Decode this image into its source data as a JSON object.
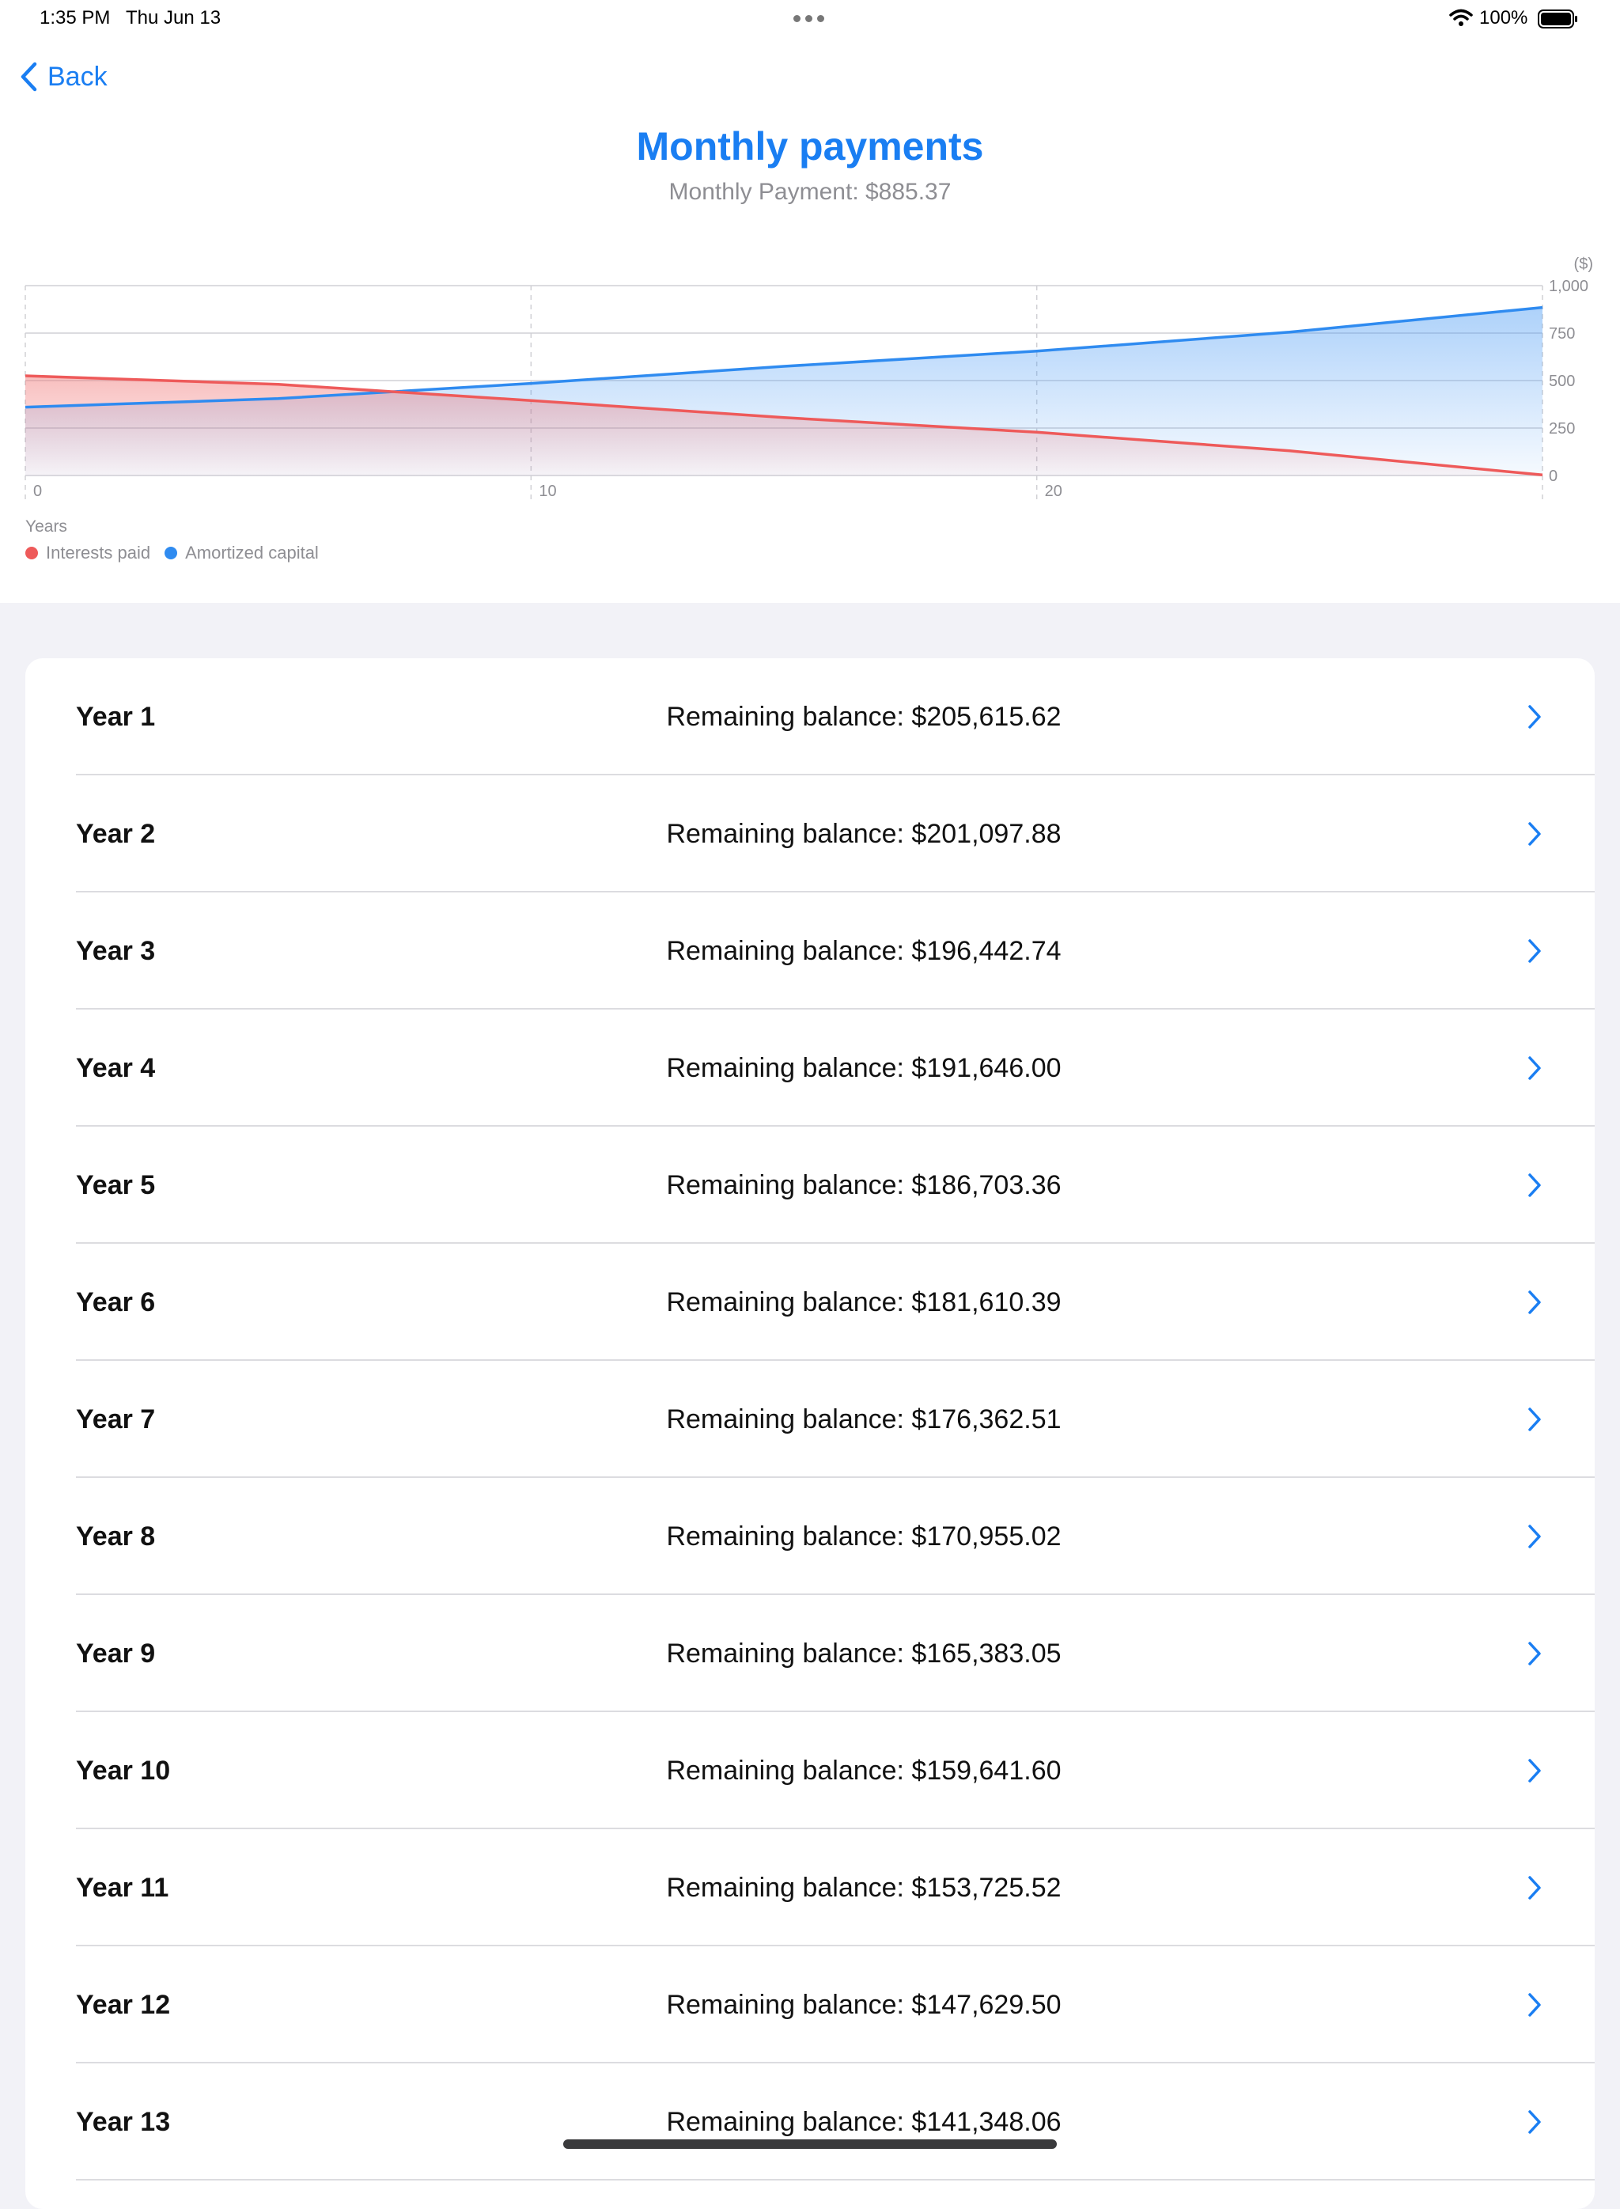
{
  "status_bar": {
    "time": "1:35 PM",
    "date": "Thu Jun 13",
    "battery": "100%"
  },
  "nav": {
    "back_label": "Back"
  },
  "header": {
    "title": "Monthly payments",
    "subtitle": "Monthly Payment: $885.37"
  },
  "chart_data": {
    "type": "area",
    "x_label": "Years",
    "y_unit": "($)",
    "x_ticks": [
      "0",
      "10",
      "20"
    ],
    "y_ticks": [
      "1,000",
      "750",
      "500",
      "250",
      "0"
    ],
    "xlim": [
      0,
      30
    ],
    "ylim": [
      0,
      1000
    ],
    "grid": true,
    "legend_position": "bottom-left",
    "series": [
      {
        "name": "Interests paid",
        "color": "#ee5a5a",
        "x": [
          0,
          5,
          10,
          15,
          20,
          25,
          30
        ],
        "values": [
          525,
          480,
          395,
          305,
          228,
          130,
          3
        ]
      },
      {
        "name": "Amortized capital",
        "color": "#2f8bf0",
        "x": [
          0,
          5,
          10,
          15,
          20,
          25,
          30
        ],
        "values": [
          360,
          405,
          485,
          575,
          655,
          755,
          885
        ]
      }
    ]
  },
  "schedule": {
    "rows": [
      {
        "year": "Year 1",
        "balance": "Remaining balance: $205,615.62"
      },
      {
        "year": "Year 2",
        "balance": "Remaining balance: $201,097.88"
      },
      {
        "year": "Year 3",
        "balance": "Remaining balance: $196,442.74"
      },
      {
        "year": "Year 4",
        "balance": "Remaining balance: $191,646.00"
      },
      {
        "year": "Year 5",
        "balance": "Remaining balance: $186,703.36"
      },
      {
        "year": "Year 6",
        "balance": "Remaining balance: $181,610.39"
      },
      {
        "year": "Year 7",
        "balance": "Remaining balance: $176,362.51"
      },
      {
        "year": "Year 8",
        "balance": "Remaining balance: $170,955.02"
      },
      {
        "year": "Year 9",
        "balance": "Remaining balance: $165,383.05"
      },
      {
        "year": "Year 10",
        "balance": "Remaining balance: $159,641.60"
      },
      {
        "year": "Year 11",
        "balance": "Remaining balance: $153,725.52"
      },
      {
        "year": "Year 12",
        "balance": "Remaining balance: $147,629.50"
      },
      {
        "year": "Year 13",
        "balance": "Remaining balance: $141,348.06"
      }
    ]
  },
  "colors": {
    "accent": "#1a7ef2",
    "interest": "#ee5a5a",
    "capital": "#2f8bf0"
  }
}
